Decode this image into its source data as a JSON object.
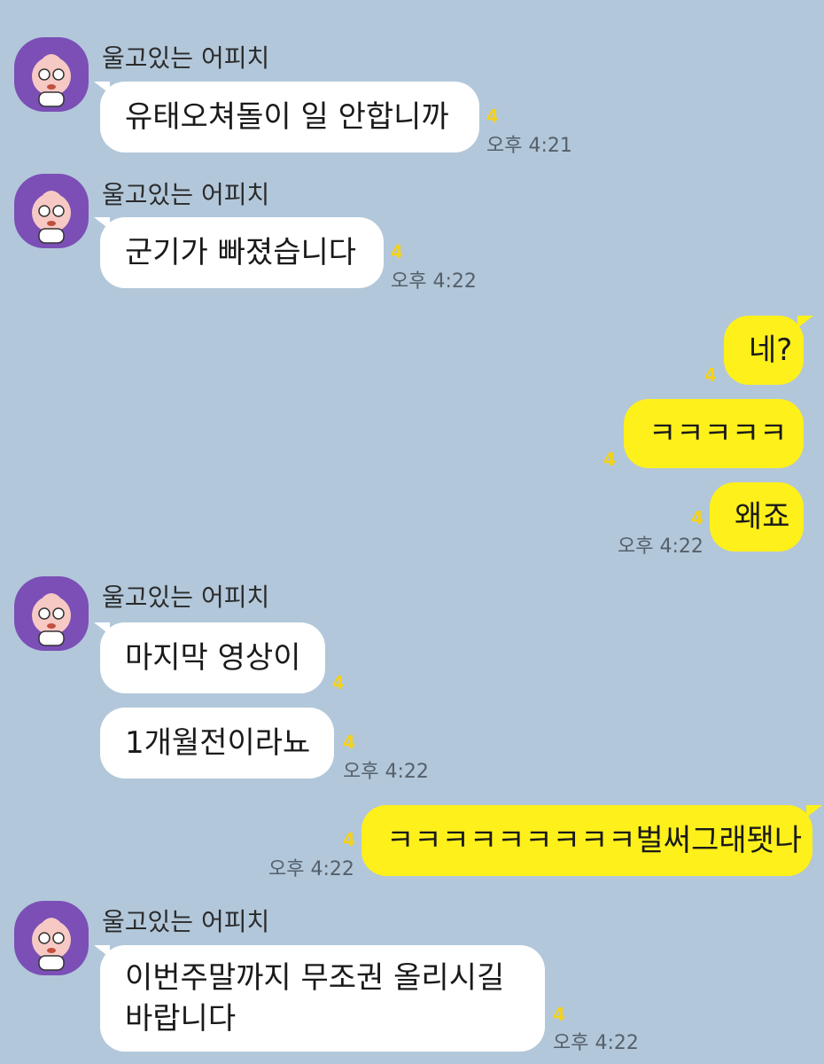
{
  "sender_name": "울고있는 어피치",
  "unread_count": "4",
  "messages": [
    {
      "text": "유태오쳐돌이 일 안합니까",
      "time": "오후 4:21"
    },
    {
      "text": "군기가 빠졌습니다",
      "time": "오후 4:22"
    },
    {
      "text": "네?"
    },
    {
      "text": "ㅋㅋㅋㅋㅋ"
    },
    {
      "text": "왜죠",
      "time": "오후 4:22"
    },
    {
      "text": "마지막 영상이"
    },
    {
      "text": "1개월전이라뇨",
      "time": "오후 4:22"
    },
    {
      "text": "ㅋㅋㅋㅋㅋㅋㅋㅋㅋ벌써그래됏나",
      "time": "오후 4:22"
    },
    {
      "text": "이번주말까지 무조권 올리시길 바랍니다",
      "time": "오후 4:22"
    }
  ],
  "colors": {
    "background": "#b2c7da",
    "incoming_bubble": "#ffffff",
    "outgoing_bubble": "#fef01b",
    "unread": "#f5d21a",
    "avatar": "#7b4fb6"
  }
}
